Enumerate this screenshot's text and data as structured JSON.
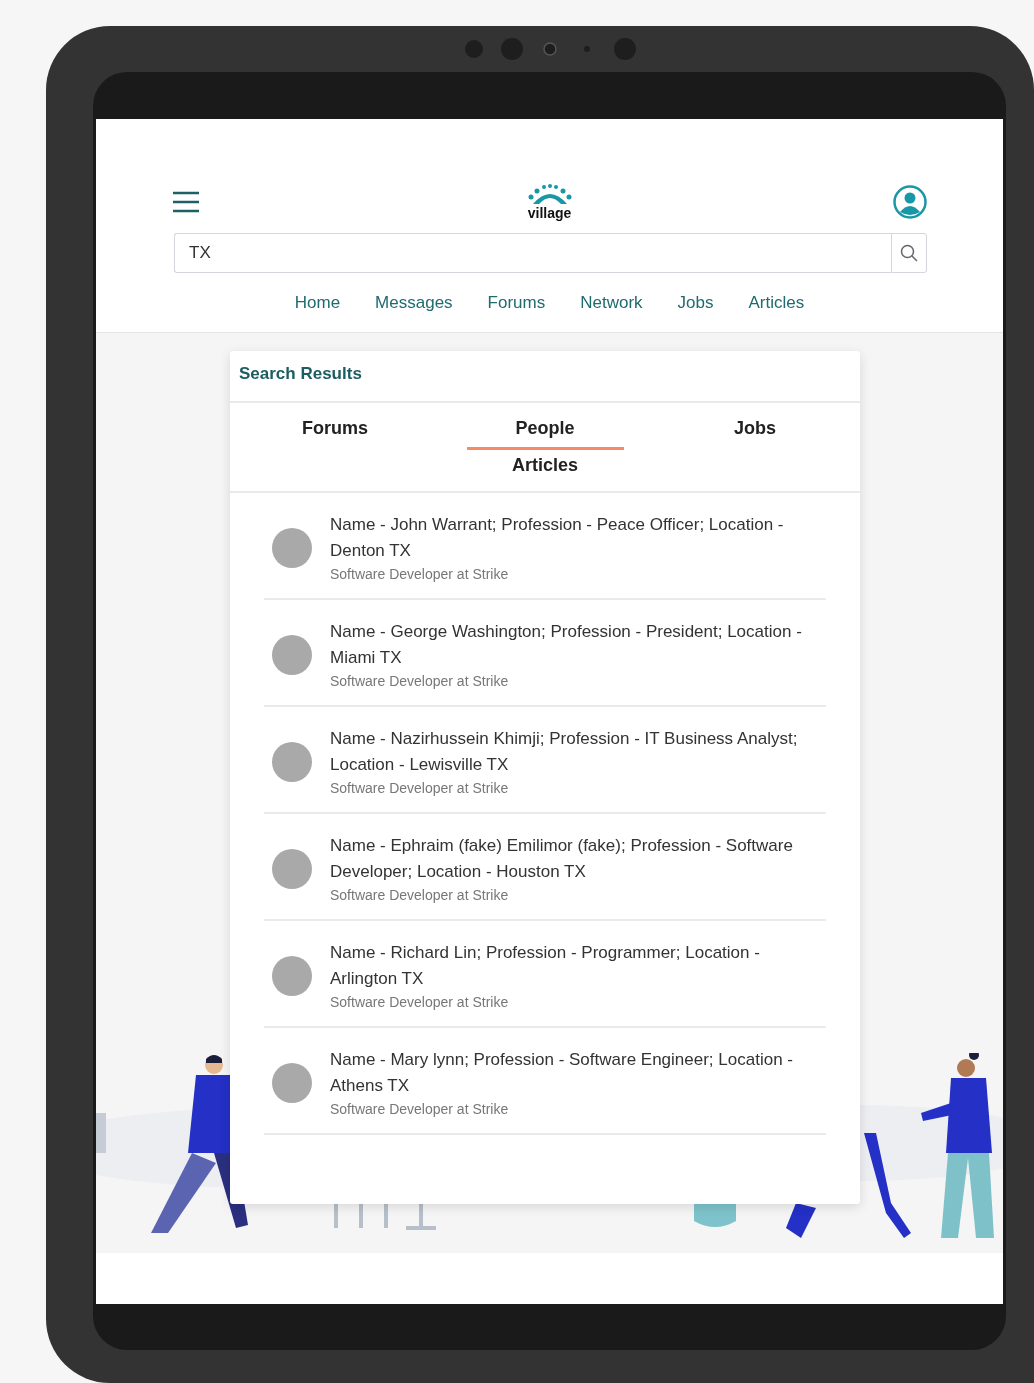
{
  "header": {
    "logo_text": "village"
  },
  "search": {
    "value": "TX"
  },
  "nav": [
    {
      "label": "Home"
    },
    {
      "label": "Messages"
    },
    {
      "label": "Forums"
    },
    {
      "label": "Network"
    },
    {
      "label": "Jobs"
    },
    {
      "label": "Articles"
    }
  ],
  "results_card": {
    "title": "Search Results",
    "tabs": [
      {
        "label": "Forums",
        "selected": false
      },
      {
        "label": "People",
        "selected": true
      },
      {
        "label": "Jobs",
        "selected": false
      },
      {
        "label": "Articles",
        "selected": false
      }
    ],
    "people": [
      {
        "text": "Name - John Warrant; Profession - Peace Officer; Location - Denton TX",
        "subtitle": "Software Developer at Strike"
      },
      {
        "text": "Name - George Washington; Profession - President; Location - Miami TX",
        "subtitle": "Software Developer at Strike"
      },
      {
        "text": "Name - Nazirhussein Khimji; Profession - IT Business Analyst; Location - Lewisville TX",
        "subtitle": "Software Developer at Strike"
      },
      {
        "text": "Name - Ephraim (fake) Emilimor (fake); Profession - Software Developer; Location - Houston TX",
        "subtitle": "Software Developer at Strike"
      },
      {
        "text": "Name - Richard Lin; Profession - Programmer; Location - Arlington TX",
        "subtitle": "Software Developer at Strike"
      },
      {
        "text": "Name - Mary lynn; Profession - Software Engineer; Location - Athens TX",
        "subtitle": "Software Developer at Strike"
      }
    ]
  }
}
